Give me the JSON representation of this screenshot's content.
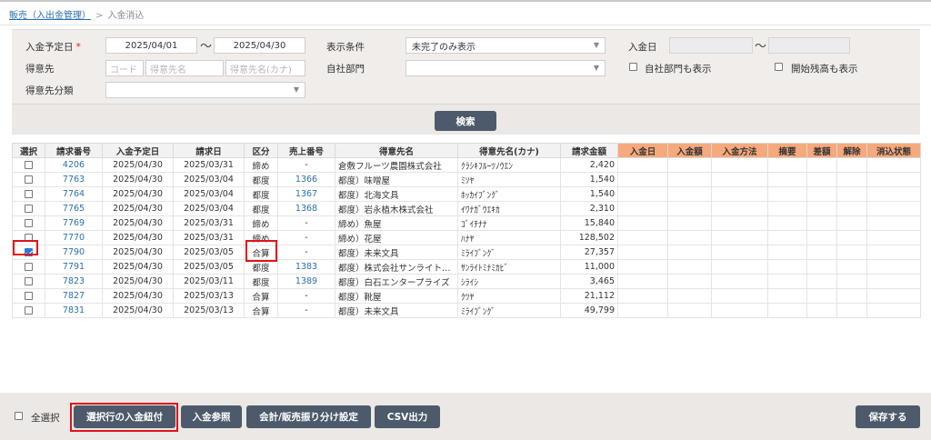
{
  "breadcrumb": {
    "parent": "販売（入出金管理）",
    "sep": ">",
    "current": "入金消込"
  },
  "filters": {
    "due_date_label": "入金予定日",
    "required_mark": "*",
    "due_from": "2025/04/01",
    "tilde": "〜",
    "due_to": "2025/04/30",
    "display_cond_label": "表示条件",
    "display_cond_value": "未完了のみ表示",
    "paid_date_label": "入金日",
    "customer_label": "得意先",
    "code_ph": "コード",
    "name_ph": "得意先名",
    "kana_ph": "得意先名(カナ)",
    "dept_label": "自社部門",
    "dept_value": "",
    "show_dept_label": "自社部門も表示",
    "show_opening_label": "開始残高も表示",
    "category_label": "得意先分類",
    "category_value": ""
  },
  "search_button": "検索",
  "table": {
    "headers": [
      "選択",
      "請求番号",
      "入金予定日",
      "請求日",
      "区分",
      "売上番号",
      "得意先名",
      "得意先名(カナ)",
      "請求金額",
      "入金日",
      "入金額",
      "入金方法",
      "摘要",
      "差額",
      "解除",
      "消込状態"
    ],
    "rows": [
      {
        "checked": false,
        "inv": "4206",
        "due": "2025/04/30",
        "bill": "2025/03/31",
        "kubun": "締め",
        "sales": "-",
        "name": "倉敷フルーツ農園株式会社",
        "kana": "ｸﾗｼｷﾌﾙｰﾂﾉｳｴﾝ",
        "amount": "2,420"
      },
      {
        "checked": false,
        "inv": "7763",
        "due": "2025/04/30",
        "bill": "2025/03/04",
        "kubun": "都度",
        "sales": "1366",
        "name": "都度）味噌屋",
        "kana": "ﾐｿﾔ",
        "amount": "1,540"
      },
      {
        "checked": false,
        "inv": "7764",
        "due": "2025/04/30",
        "bill": "2025/03/04",
        "kubun": "都度",
        "sales": "1367",
        "name": "都度）北海文具",
        "kana": "ﾎｯｶｲﾌﾞﾝｸﾞ",
        "amount": "1,540"
      },
      {
        "checked": false,
        "inv": "7765",
        "due": "2025/04/30",
        "bill": "2025/03/04",
        "kubun": "都度",
        "sales": "1368",
        "name": "都度）岩永植木株式会社",
        "kana": "ｲﾜﾅｶﾞｳｴｷｶ",
        "amount": "2,310"
      },
      {
        "checked": false,
        "inv": "7769",
        "due": "2025/04/30",
        "bill": "2025/03/31",
        "kubun": "締め",
        "sales": "-",
        "name": "締め）魚屋",
        "kana": "ｺﾞｲﾁﾅﾅ",
        "amount": "15,840"
      },
      {
        "checked": false,
        "inv": "7770",
        "due": "2025/04/30",
        "bill": "2025/03/31",
        "kubun": "締め",
        "sales": "-",
        "name": "締め）花屋",
        "kana": "ﾊﾅﾔ",
        "amount": "128,502"
      },
      {
        "checked": true,
        "inv": "7790",
        "due": "2025/04/30",
        "bill": "2025/03/05",
        "kubun": "合算",
        "sales": "-",
        "name": "都度）未来文具",
        "kana": "ﾐﾗｲﾌﾞﾝｸﾞ",
        "amount": "27,357"
      },
      {
        "checked": false,
        "inv": "7791",
        "due": "2025/04/30",
        "bill": "2025/03/05",
        "kubun": "都度",
        "sales": "1383",
        "name": "都度）株式会社サンライト…",
        "kana": "ｻﾝﾗｲﾄﾐﾅﾐｶﾋﾞ",
        "amount": "11,000"
      },
      {
        "checked": false,
        "inv": "7823",
        "due": "2025/04/30",
        "bill": "2025/03/11",
        "kubun": "都度",
        "sales": "1389",
        "name": "都度）白石エンタープライズ",
        "kana": "ｼﾗｲｼ",
        "amount": "3,465"
      },
      {
        "checked": false,
        "inv": "7827",
        "due": "2025/04/30",
        "bill": "2025/03/13",
        "kubun": "合算",
        "sales": "-",
        "name": "都度）靴屋",
        "kana": "ｸﾂﾔ",
        "amount": "21,112"
      },
      {
        "checked": false,
        "inv": "7831",
        "due": "2025/04/30",
        "bill": "2025/03/13",
        "kubun": "合算",
        "sales": "-",
        "name": "都度）未来文具",
        "kana": "ﾐﾗｲﾌﾞﾝｸﾞ",
        "amount": "49,799"
      }
    ]
  },
  "footer": {
    "select_all": "全選択",
    "btn_link": "選択行の入金紐付",
    "btn_ref": "入金参照",
    "btn_setting": "会計/販売振り分け設定",
    "btn_csv": "CSV出力",
    "btn_save": "保存する"
  },
  "colors": {
    "button": "#4c5a6b",
    "header_orange": "#f5a97c",
    "link": "#2a6fb0",
    "highlight": "#e0131a"
  }
}
